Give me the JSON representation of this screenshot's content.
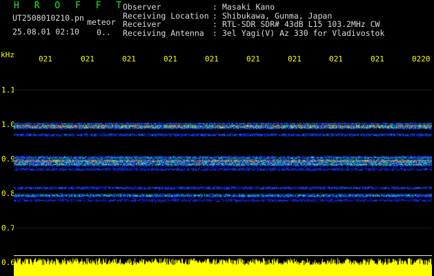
{
  "brand": "H R O F F T",
  "file": {
    "name": "UT2508010210.pn",
    "type": "meteor",
    "datetime": "25.08.01 02:10",
    "counter": "0.."
  },
  "meta": [
    {
      "label": "Observer",
      "sep": ":",
      "value": "Masaki Kano"
    },
    {
      "label": "Receiving Location",
      "sep": ":",
      "value": "Shibukawa, Gunma, Japan"
    },
    {
      "label": "Receiver",
      "sep": ":",
      "value": "RTL-SDR SDR# 43dB L15 103.2MHz CW"
    },
    {
      "label": "Receiving Antenna",
      "sep": ":",
      "value": "3el Yagi(V) Az 330 for Vladivostok"
    }
  ],
  "axis": {
    "unit": "kHz",
    "y_ticks": [
      "1.1",
      "1.0",
      "0.9",
      "0.8",
      "0.7",
      "0.6"
    ],
    "x_ticks": [
      "021",
      "021",
      "021",
      "021",
      "021",
      "021",
      "021",
      "021",
      "021",
      "0220"
    ]
  },
  "colors": {
    "axis_text": "#ffff00",
    "info_text": "#dcdcdc",
    "brand": "#22ee22",
    "signal_fill": "#ffff00",
    "baseline": "#f0f0f0"
  }
}
